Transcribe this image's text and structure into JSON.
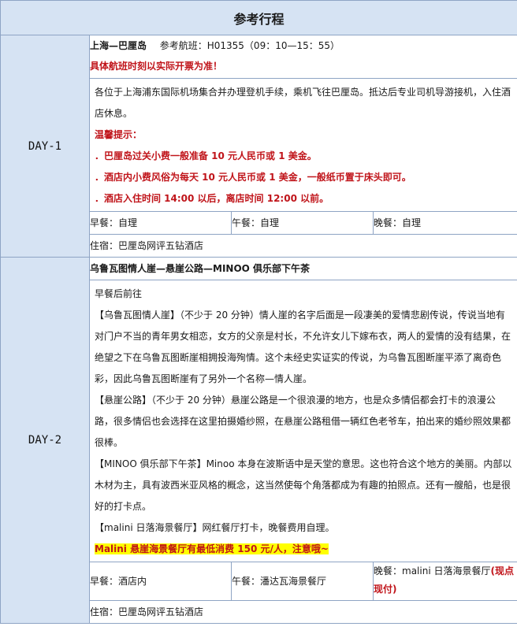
{
  "title": "参考行程",
  "day1": {
    "label": "DAY-1",
    "route": "上海—巴厘岛",
    "flight_label": "参考航班：H01355（09：10—15：55）",
    "flight_note": "具体航班时刻以实际开票为准！",
    "intro": "各位于上海浦东国际机场集合并办理登机手续，乘机飞往巴厘岛。抵达后专业司机导游接机，入住酒店休息。",
    "tips_title": "温馨提示：",
    "tips": [
      "．巴厘岛过关小费一般准备 10 元人民币或 1 美金。",
      "．酒店内小费风俗为每天 10 元人民币或 1 美金，一般纸币置于床头即可。",
      "．酒店入住时间 14:00 以后，离店时间 12:00 以前。"
    ],
    "breakfast": "早餐：自理",
    "lunch": "午餐：自理",
    "dinner": "晚餐：自理",
    "stay": "住宿：巴厘岛网评五钻酒店"
  },
  "day2": {
    "label": "DAY-2",
    "route": "乌鲁瓦图情人崖—悬崖公路—MINOO 俱乐部下午茶",
    "line1": "早餐后前往",
    "p1_title": "【乌鲁瓦图情人崖】",
    "p1": "（不少于 20 分钟）情人崖的名字后面是一段凄美的爱情悲剧传说，传说当地有对门户不当的青年男女相恋，女方的父亲是村长，不允许女儿下嫁布衣，两人的爱情的没有结果，在绝望之下在乌鲁瓦图断崖相拥投海殉情。这个未经史实证实的传说，为乌鲁瓦图断崖平添了离奇色彩，因此乌鲁瓦图断崖有了另外一个名称—情人崖。",
    "p2_title": "【悬崖公路】",
    "p2": "（不少于 20 分钟）悬崖公路是一个很浪漫的地方，也是众多情侣都会打卡的浪漫公路，很多情侣也会选择在这里拍摄婚纱照，在悬崖公路租借一辆红色老爷车，拍出来的婚纱照效果都很棒。",
    "p3_title": "【MINOO 俱乐部下午茶】",
    "p3": "Minoo 本身在波斯语中是天堂的意思。这也符合这个地方的美丽。内部以木材为主，具有波西米亚风格的概念，这当然使每个角落都成为有趣的拍照点。还有一艘船，也是很好的打卡点。",
    "p4_title": "【malini 日落海景餐厅】",
    "p4": "网红餐厅打卡，晚餐费用自理。",
    "notice": "Malini 悬崖海景餐厅有最低消费 150 元/人，注意哦~",
    "breakfast": "早餐：酒店内",
    "lunch": "午餐：潘达瓦海景餐厅",
    "dinner": "晚餐：malini 日落海景餐厅",
    "dinner_note": "(现点现付)",
    "stay": "住宿：巴厘岛网评五钻酒店"
  }
}
